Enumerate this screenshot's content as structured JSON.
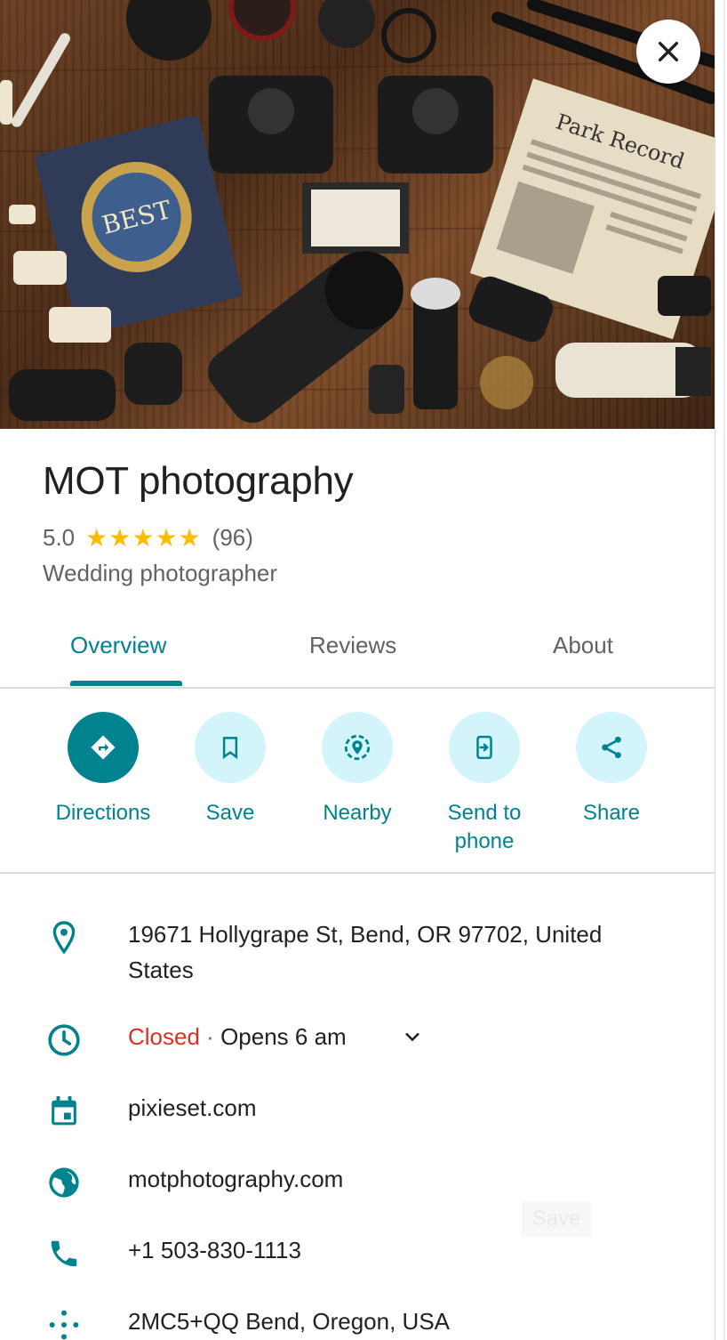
{
  "colors": {
    "accent": "#00838f",
    "accent_light": "#d3f4fb",
    "star": "#fbbc04",
    "closed": "#d93025",
    "text_primary": "#202124",
    "text_secondary": "#5f6368"
  },
  "hero": {
    "image": "photography-gear-flatlay",
    "close_icon": "close-icon"
  },
  "place": {
    "name": "MOT photography",
    "rating": "5.0",
    "stars": "★★★★★",
    "stars_value": 5,
    "review_count": "(96)",
    "category": "Wedding photographer"
  },
  "tabs": [
    {
      "label": "Overview",
      "active": true
    },
    {
      "label": "Reviews",
      "active": false
    },
    {
      "label": "About",
      "active": false
    }
  ],
  "actions": [
    {
      "label": "Directions",
      "icon": "directions-icon"
    },
    {
      "label": "Save",
      "icon": "bookmark-icon"
    },
    {
      "label": "Nearby",
      "icon": "nearby-icon"
    },
    {
      "label": "Send to phone",
      "icon": "send-to-phone-icon"
    },
    {
      "label": "Share",
      "icon": "share-icon"
    }
  ],
  "info": {
    "address": "19671 Hollygrape St, Bend, OR 97702, United States",
    "hours_status": "Closed",
    "hours_separator": "·",
    "hours_next": "Opens 6 am",
    "booking": "pixieset.com",
    "website": "motphotography.com",
    "phone": "+1 503-830-1113",
    "plus_code": "2MC5+QQ Bend, Oregon, USA"
  },
  "ghost_button": {
    "label": "Save"
  }
}
